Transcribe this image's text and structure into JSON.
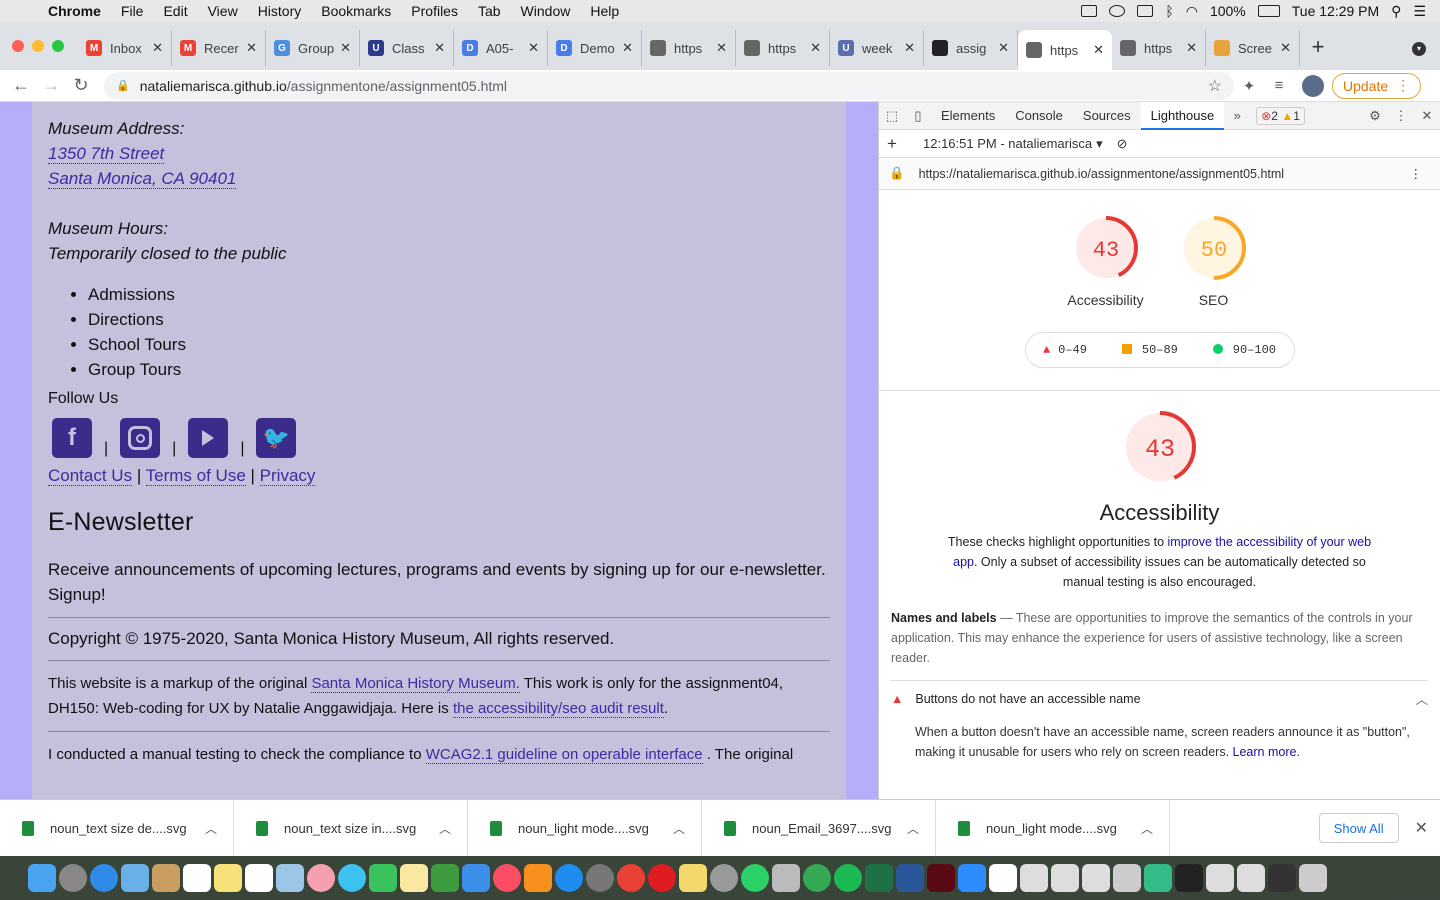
{
  "menubar": {
    "app": "Chrome",
    "items": [
      "File",
      "Edit",
      "View",
      "History",
      "Bookmarks",
      "Profiles",
      "Tab",
      "Window",
      "Help"
    ],
    "battery": "100%",
    "clock": "Tue 12:29 PM"
  },
  "tabs": [
    {
      "title": "Inbox",
      "fav": "M",
      "color": "#ea4335"
    },
    {
      "title": "Recer",
      "fav": "M",
      "color": "#ea4335"
    },
    {
      "title": "Group",
      "fav": "G",
      "color": "#4a8fe0"
    },
    {
      "title": "Class",
      "fav": "U",
      "color": "#2d3a8c"
    },
    {
      "title": "A05-",
      "fav": "D",
      "color": "#4a7de8"
    },
    {
      "title": "Demo",
      "fav": "D",
      "color": "#4a7de8"
    },
    {
      "title": "https",
      "fav": "",
      "color": "#666"
    },
    {
      "title": "https",
      "fav": "",
      "color": "#666"
    },
    {
      "title": "week",
      "fav": "U",
      "color": "#5a6fae"
    },
    {
      "title": "assig",
      "fav": "",
      "color": "#222"
    },
    {
      "title": "https",
      "fav": "",
      "color": "#666",
      "active": true
    },
    {
      "title": "https",
      "fav": "",
      "color": "#666"
    },
    {
      "title": "Scree",
      "fav": "",
      "color": "#e7a33c"
    }
  ],
  "toolbar": {
    "url_host": "nataliemarisca.github.io",
    "url_path": "/assignmentone/assignment05.html",
    "update_label": "Update"
  },
  "page": {
    "address_label": "Museum Address:",
    "address_line1": "1350 7th Street",
    "address_line2": "Santa Monica, CA 90401",
    "hours_label": "Museum Hours:",
    "hours_value": "Temporarily closed to the public",
    "list": [
      "Admissions",
      "Directions",
      "School Tours",
      "Group Tours"
    ],
    "follow": "Follow Us",
    "contact": "Contact Us",
    "terms": "Terms of Use",
    "privacy": "Privacy",
    "newsletter_heading": "E-Newsletter",
    "newsletter_text": "Receive announcements of upcoming lectures, programs and events by signing up for our e-newsletter.",
    "signup": "Signup!",
    "copyright": "Copyright © 1975-2020, Santa Monica History Museum, All rights reserved.",
    "markup_pre": "This website is a markup of the original ",
    "markup_link": "Santa Monica History Museum.",
    "markup_post": " This work is only for the assignment04, DH150: Web-coding for UX by Natalie Anggawidjaja. Here is ",
    "audit_link": "the accessibility/seo audit result",
    "manual_pre": "I conducted a manual testing to check the compliance to ",
    "manual_link": "WCAG2.1 guideline on operable interface",
    "manual_post": " . The original"
  },
  "devtools": {
    "tabs": [
      "Elements",
      "Console",
      "Sources",
      "Lighthouse"
    ],
    "errors": "2",
    "warnings": "1",
    "report_time": "12:16:51 PM - nataliemarisca",
    "report_url": "https://nataliemarisca.github.io/assignmentone/assignment05.html",
    "scores": [
      {
        "label": "Accessibility",
        "score": 43,
        "color": "#e53935",
        "bg": "#fde9e8"
      },
      {
        "label": "SEO",
        "score": 50,
        "color": "#f9a825",
        "bg": "#fff5e1"
      }
    ],
    "legend": [
      "0–49",
      "50–89",
      "90–100"
    ],
    "category_title": "Accessibility",
    "category_desc_pre": "These checks highlight opportunities to ",
    "category_desc_link": "improve the accessibility of your web app",
    "category_desc_post": ". Only a subset of accessibility issues can be automatically detected so manual testing is also encouraged.",
    "group_title": "Names and labels",
    "group_desc": "These are opportunities to improve the semantics of the controls in your application. This may enhance the experience for users of assistive technology, like a screen reader.",
    "audit_title": "Buttons do not have an accessible name",
    "audit_desc": "When a button doesn't have an accessible name, screen readers announce it as \"button\", making it unusable for users who rely on screen readers.",
    "learn_more": "Learn more"
  },
  "downloads": {
    "items": [
      "noun_text size de....svg",
      "noun_text size in....svg",
      "noun_light mode....svg",
      "noun_Email_3697....svg",
      "noun_light mode....svg"
    ],
    "show_all": "Show All"
  }
}
